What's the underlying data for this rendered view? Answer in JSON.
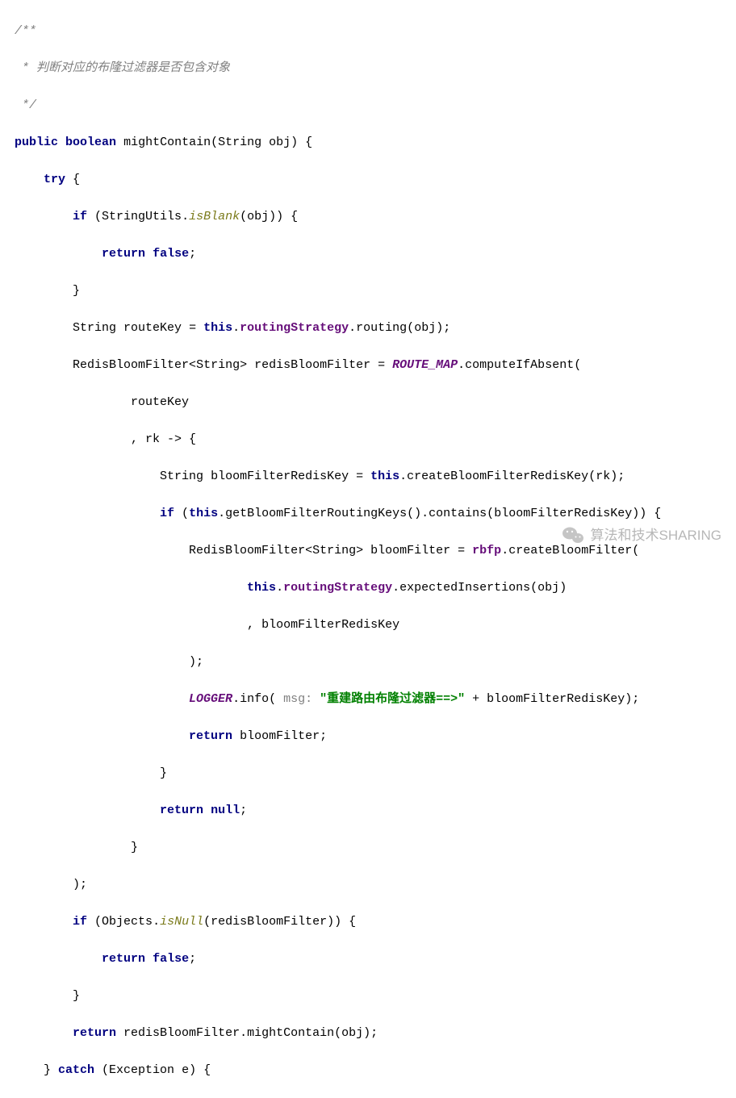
{
  "code": {
    "l1": "/**",
    "l2_star": " * ",
    "l2_text": "判断对应的布隆过滤器是否包含对象",
    "l3": " */",
    "l4_kw_public": "public",
    "l4_kw_boolean": "boolean",
    "l4_method": "mightContain",
    "l4_type": "String",
    "l4_param": "obj",
    "l5_kw_try": "try",
    "l6_kw_if": "if",
    "l6_class": "StringUtils",
    "l6_method": "isBlank",
    "l6_arg": "obj",
    "l7_kw_return": "return",
    "l7_kw_false": "false",
    "l9_type": "String",
    "l9_var": "routeKey",
    "l9_kw_this": "this",
    "l9_field": "routingStrategy",
    "l9_method": "routing",
    "l9_arg": "obj",
    "l10_type": "RedisBloomFilter",
    "l10_generic": "String",
    "l10_var": "redisBloomFilter",
    "l10_const": "ROUTE_MAP",
    "l10_method": "computeIfAbsent",
    "l11_arg": "routeKey",
    "l12_lambda": "rk",
    "l13_type": "String",
    "l13_var": "bloomFilterRedisKey",
    "l13_kw_this": "this",
    "l13_method": "createBloomFilterRedisKey",
    "l13_arg": "rk",
    "l14_kw_if": "if",
    "l14_kw_this": "this",
    "l14_method1": "getBloomFilterRoutingKeys",
    "l14_method2": "contains",
    "l14_arg": "bloomFilterRedisKey",
    "l15_type": "RedisBloomFilter",
    "l15_generic": "String",
    "l15_var": "bloomFilter",
    "l15_obj": "rbfp",
    "l15_method": "createBloomFilter",
    "l16_kw_this": "this",
    "l16_field": "routingStrategy",
    "l16_method": "expectedInsertions",
    "l16_arg": "obj",
    "l17_arg": "bloomFilterRedisKey",
    "l19_logger": "LOGGER",
    "l19_method": "info",
    "l19_hint": "msg:",
    "l19_str": "\"重建路由布隆过滤器==>\"",
    "l19_plus": "bloomFilterRedisKey",
    "l20_kw_return": "return",
    "l20_var": "bloomFilter",
    "l22_kw_return": "return",
    "l22_kw_null": "null",
    "l25_kw_if": "if",
    "l25_class": "Objects",
    "l25_method": "isNull",
    "l25_arg": "redisBloomFilter",
    "l26_kw_return": "return",
    "l26_kw_false": "false",
    "l28_kw_return": "return",
    "l28_var": "redisBloomFilter",
    "l28_method": "mightContain",
    "l28_arg": "obj",
    "l29_kw_catch": "catch",
    "l29_type": "Exception",
    "l29_var": "e"
  },
  "watermark": "算法和技术SHARING"
}
